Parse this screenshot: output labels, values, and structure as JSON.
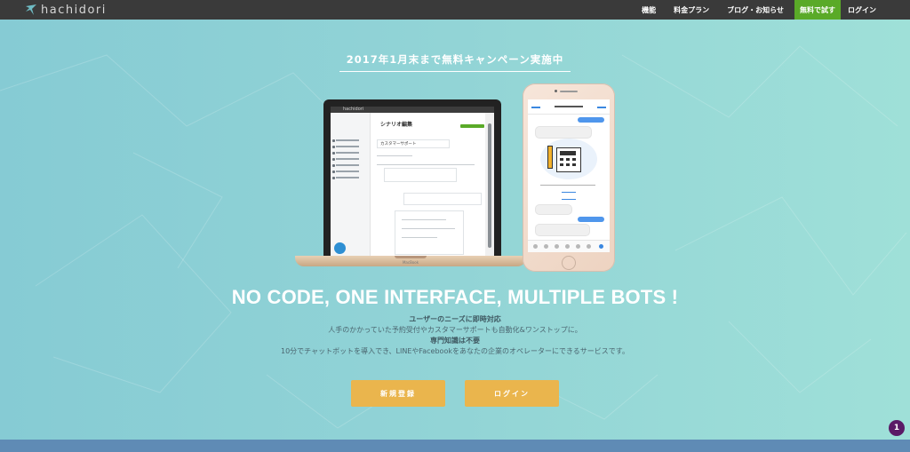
{
  "nav": {
    "brand": "hachidori",
    "links": [
      "機能",
      "料金プラン",
      "ブログ・お知らせ"
    ],
    "trial_label": "無料で試す",
    "login_label": "ログイン"
  },
  "campaign": {
    "text": "2017年1月末まで無料キャンペーン実施中"
  },
  "devices": {
    "laptop_title": "シナリオ編集",
    "laptop_field": "カスタマーサポート",
    "laptop_brand": "MacBook"
  },
  "hero": {
    "headline": "NO CODE, ONE INTERFACE, MULTIPLE BOTS !",
    "line1": "ユーザーのニーズに即時対応",
    "line2": "人手のかかっていた予約受付やカスタマーサポートも自動化&ワンストップに。",
    "line3": "専門知識は不要",
    "line4": "10分でチャットボットを導入でき、LINEやFacebookをあなたの企業のオペレーターにできるサービスです。"
  },
  "buttons": {
    "signup": "新規登録",
    "login": "ログイン"
  },
  "badge": {
    "count": "1"
  },
  "colors": {
    "nav_bg": "#3a3a3a",
    "trial_green": "#5aaa28",
    "cta_orange": "#eab54d",
    "badge_purple": "#5a1a66"
  }
}
